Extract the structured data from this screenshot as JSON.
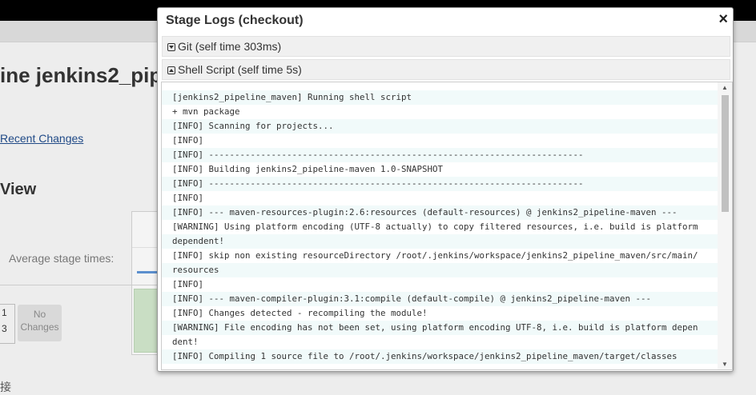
{
  "background": {
    "title": "ine jenkins2_pip",
    "recent_changes": "Recent Changes",
    "view_heading": "View",
    "average_stage_times": "Average stage times:",
    "build_number_top": "1",
    "build_number_bottom": "3",
    "no_changes": "No Changes",
    "bottom_text": "接"
  },
  "modal": {
    "title": "Stage Logs (checkout)",
    "close": "×",
    "steps": [
      {
        "label": "Git (self time 303ms)",
        "state": "collapsed"
      },
      {
        "label": "Shell Script (self time 5s)",
        "state": "expanded"
      }
    ],
    "log_lines": [
      "[jenkins2_pipeline_maven] Running shell script",
      "+ mvn package",
      "[INFO] Scanning for projects...",
      "[INFO]",
      "[INFO] ------------------------------------------------------------------------",
      "[INFO] Building jenkins2_pipeline-maven 1.0-SNAPSHOT",
      "[INFO] ------------------------------------------------------------------------",
      "[INFO]",
      "[INFO] --- maven-resources-plugin:2.6:resources (default-resources) @ jenkins2_pipeline-maven ---",
      "[WARNING] Using platform encoding (UTF-8 actually) to copy filtered resources, i.e. build is platform",
      "dependent!",
      "[INFO] skip non existing resourceDirectory /root/.jenkins/workspace/jenkins2_pipeline_maven/src/main/",
      "resources",
      "[INFO]",
      "[INFO] --- maven-compiler-plugin:3.1:compile (default-compile) @ jenkins2_pipeline-maven ---",
      "[INFO] Changes detected - recompiling the module!",
      "[WARNING] File encoding has not been set, using platform encoding UTF-8, i.e. build is platform depen",
      "dent!",
      "[INFO] Compiling 1 source file to /root/.jenkins/workspace/jenkins2_pipeline_maven/target/classes"
    ]
  }
}
